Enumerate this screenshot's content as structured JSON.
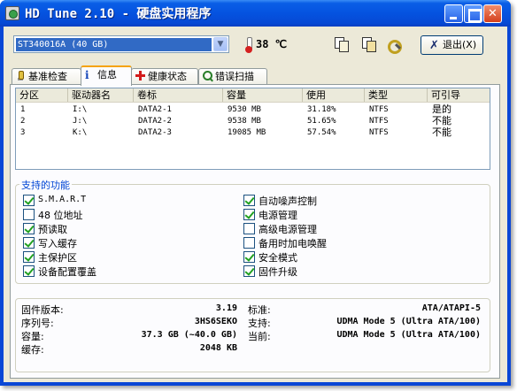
{
  "window": {
    "title": "HD Tune 2.10 - 硬盘实用程序"
  },
  "toolbar": {
    "drive": "ST340016A (40 GB)",
    "temperature": "38 ℃",
    "exit_label": "退出(X)"
  },
  "tabs": [
    {
      "label": "基准检查"
    },
    {
      "label": "信息"
    },
    {
      "label": "健康状态"
    },
    {
      "label": "错误扫描"
    }
  ],
  "partitions": {
    "columns": [
      "分区",
      "驱动器名",
      "卷标",
      "容量",
      "使用",
      "类型",
      "可引导"
    ],
    "rows": [
      {
        "partition": "1",
        "drive": "I:\\",
        "label": "DATA2-1",
        "capacity": "9530 MB",
        "used": "31.18%",
        "type": "NTFS",
        "bootable": "是的"
      },
      {
        "partition": "2",
        "drive": "J:\\",
        "label": "DATA2-2",
        "capacity": "9538 MB",
        "used": "51.65%",
        "type": "NTFS",
        "bootable": "不能"
      },
      {
        "partition": "3",
        "drive": "K:\\",
        "label": "DATA2-3",
        "capacity": "19085 MB",
        "used": "57.54%",
        "type": "NTFS",
        "bootable": "不能"
      }
    ]
  },
  "features": {
    "title": "支持的功能",
    "left": [
      {
        "label": "S.M.A.R.T",
        "checked": true
      },
      {
        "label": "48 位地址",
        "checked": false
      },
      {
        "label": "预读取",
        "checked": true
      },
      {
        "label": "写入缓存",
        "checked": true
      },
      {
        "label": "主保护区",
        "checked": true
      },
      {
        "label": "设备配置覆盖",
        "checked": true
      }
    ],
    "right": [
      {
        "label": "自动噪声控制",
        "checked": true
      },
      {
        "label": "电源管理",
        "checked": true
      },
      {
        "label": "高级电源管理",
        "checked": false
      },
      {
        "label": "备用时加电唤醒",
        "checked": false
      },
      {
        "label": "安全模式",
        "checked": true
      },
      {
        "label": "固件升级",
        "checked": true
      }
    ]
  },
  "details": {
    "firmware_label": "固件版本:",
    "firmware_value": "3.19",
    "serial_label": "序列号:",
    "serial_value": "3HS6SEKO",
    "capacity_label": "容量:",
    "capacity_value": "37.3 GB (~40.0 GB)",
    "cache_label": "缓存:",
    "cache_value": "2048 KB",
    "standard_label": "标准:",
    "standard_value": "ATA/ATAPI-5",
    "supported_label": "支持:",
    "supported_value": "UDMA Mode 5 (Ultra ATA/100)",
    "current_label": "当前:",
    "current_value": "UDMA Mode 5 (Ultra ATA/100)"
  }
}
